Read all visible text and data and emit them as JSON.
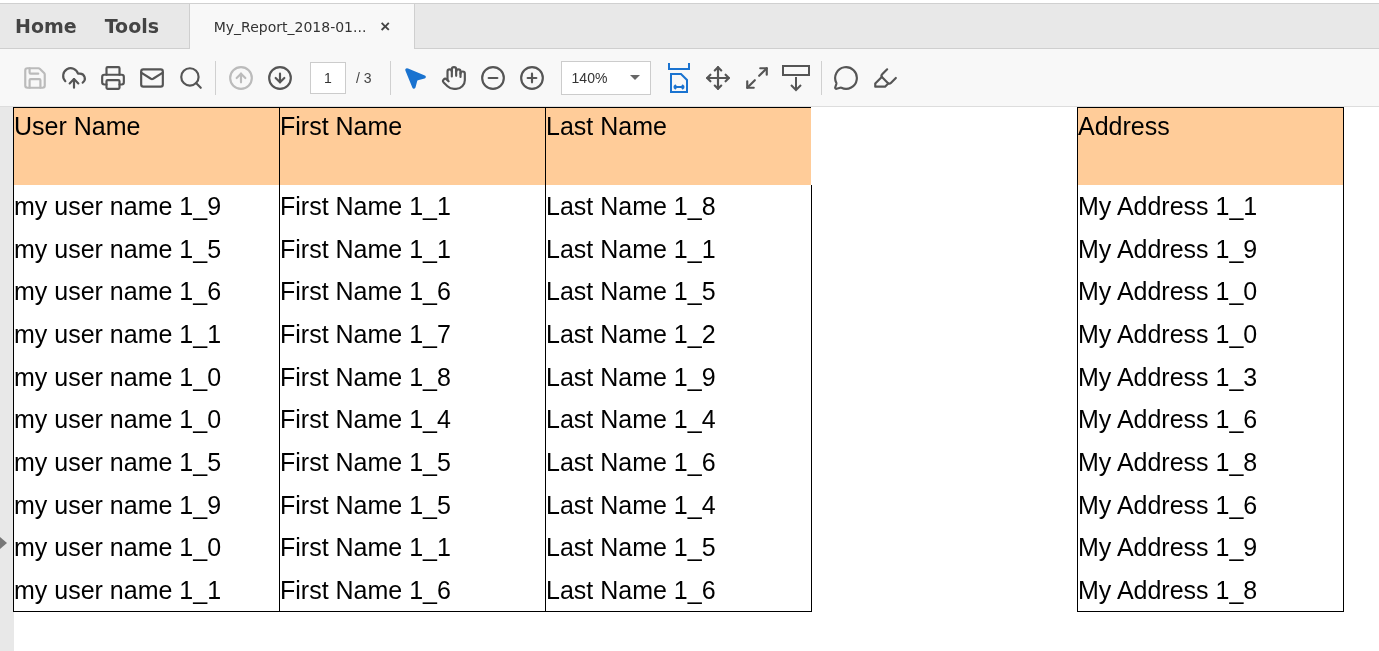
{
  "nav_tabs": [
    {
      "label": "Home",
      "selected": false
    },
    {
      "label": "Tools",
      "selected": false
    }
  ],
  "document_tab": {
    "title": "My_Report_2018-01...",
    "close": "×",
    "selected": true
  },
  "toolbar": {
    "groups": [
      [
        {
          "kind": "save",
          "disabled": true
        },
        {
          "kind": "upload",
          "disabled": false
        },
        {
          "kind": "print",
          "disabled": false
        },
        {
          "kind": "mail",
          "disabled": false
        },
        {
          "kind": "search",
          "disabled": false
        }
      ],
      [
        {
          "kind": "prev",
          "disabled": true
        },
        {
          "kind": "next",
          "disabled": false
        },
        {
          "kind": "page",
          "value": "1",
          "total": "/ 3"
        }
      ],
      [
        {
          "kind": "select",
          "selected": true
        },
        {
          "kind": "hand",
          "selected": false
        },
        {
          "kind": "zoom_out",
          "disabled": false
        },
        {
          "kind": "zoom_in",
          "disabled": false
        },
        {
          "kind": "zoom",
          "value": "140%"
        },
        {
          "kind": "fit_width",
          "selected": true
        },
        {
          "kind": "fit_page",
          "selected": false
        },
        {
          "kind": "full_screen",
          "selected": false
        },
        {
          "kind": "scroll_mode",
          "selected": false
        }
      ],
      [
        {
          "kind": "comment",
          "selected": false
        },
        {
          "kind": "highlight",
          "selected": false
        }
      ]
    ]
  },
  "table": {
    "columns": [
      "User Name",
      "First Name",
      "Last Name",
      "",
      "Address"
    ],
    "rows": [
      [
        "my user name 1_9",
        "First Name 1_1",
        "Last Name 1_8",
        "",
        "My Address 1_1"
      ],
      [
        "my user name 1_5",
        "First Name 1_1",
        "Last Name 1_1",
        "",
        "My Address 1_9"
      ],
      [
        "my user name 1_6",
        "First Name 1_6",
        "Last Name 1_5",
        "",
        "My Address 1_0"
      ],
      [
        "my user name 1_1",
        "First Name 1_7",
        "Last Name 1_2",
        "",
        "My Address 1_0"
      ],
      [
        "my user name 1_0",
        "First Name 1_8",
        "Last Name 1_9",
        "",
        "My Address 1_3"
      ],
      [
        "my user name 1_0",
        "First Name 1_4",
        "Last Name 1_4",
        "",
        "My Address 1_6"
      ],
      [
        "my user name 1_5",
        "First Name 1_5",
        "Last Name 1_6",
        "",
        "My Address 1_8"
      ],
      [
        "my user name 1_9",
        "First Name 1_5",
        "Last Name 1_4",
        "",
        "My Address 1_6"
      ],
      [
        "my user name 1_0",
        "First Name 1_1",
        "Last Name 1_5",
        "",
        "My Address 1_9"
      ],
      [
        "my user name 1_1",
        "First Name 1_6",
        "Last Name 1_6",
        "",
        "My Address 1_8"
      ]
    ]
  }
}
